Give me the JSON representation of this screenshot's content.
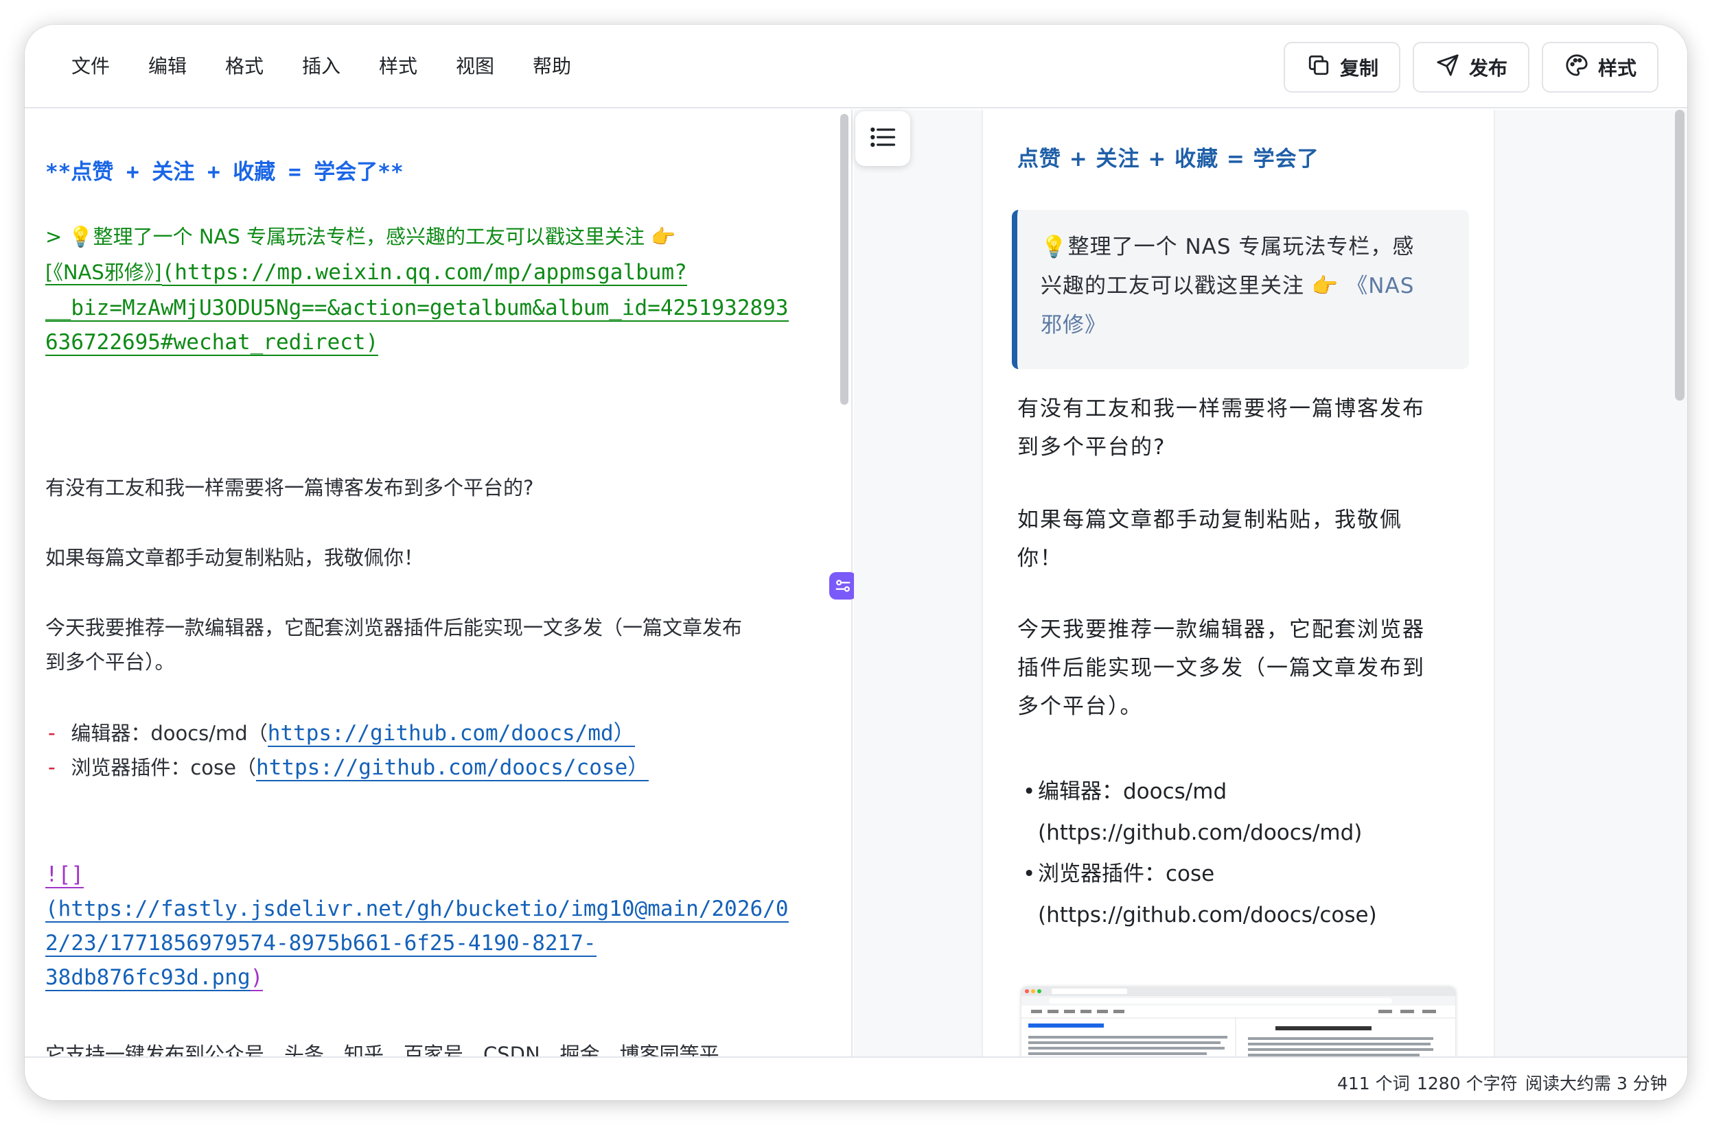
{
  "menu": [
    "文件",
    "编辑",
    "格式",
    "插入",
    "样式",
    "视图",
    "帮助"
  ],
  "toolbar": {
    "copy_label": "复制",
    "publish_label": "发布",
    "style_label": "样式"
  },
  "editor": {
    "heading": "**点赞 + 关注 + 收藏 = 学会了**",
    "quote_prefix": "> 💡整理了一个 NAS 专属玩法专栏，感兴趣的工友可以戳这里关注 👉",
    "quote_link_text": "[《NAS邪修》]",
    "quote_link_url_1": "(https://mp.weixin.qq.com/mp/appmsgalbum?",
    "quote_link_url_2": "__biz=MzAwMjU3ODU5Ng==&action=getalbum&album_id=4251932893",
    "quote_link_url_3": "636722695#wechat_redirect",
    "quote_link_close": ")",
    "p1": "有没有工友和我一样需要将一篇博客发布到多个平台的?",
    "p2": "如果每篇文章都手动复制粘贴，我敬佩你！",
    "p3_1": "今天我要推荐一款编辑器，它配套浏览器插件后能实现一文多发（一篇文章发布",
    "p3_2": "到多个平台）。",
    "li1_dash": "-",
    "li1_label": "编辑器：doocs/md（",
    "li1_link": "https://github.com/doocs/md）",
    "li2_dash": "-",
    "li2_label": "浏览器插件：cose（",
    "li2_link": "https://github.com/doocs/cose）",
    "img_mark": "![]",
    "img_url_1": "(https://fastly.jsdelivr.net/gh/bucketio/img10@main/2026/0",
    "img_url_2": "2/23/1771856979574-8975b661-6f25-4190-8217-",
    "img_url_3": "38db876fc93d.png",
    "img_close": ")",
    "partial_line": "它支持一键发布到公众号、头条、知乎、百家号、CSDN、掘金、博客园等平"
  },
  "preview": {
    "heading": "点赞 + 关注 + 收藏 = 学会了",
    "quote_1": "💡整理了一个 NAS 专属玩法专栏，感",
    "quote_2": "兴趣的工友可以戳这里关注 👉",
    "quote_link_1": "《NAS",
    "quote_link_2": "邪修》",
    "p1_1": "有没有工友和我一样需要将一篇博客发布",
    "p1_2": "到多个平台的?",
    "p2_1": "如果每篇文章都手动复制粘贴，我敬佩",
    "p2_2": "你！",
    "p3_1": "今天我要推荐一款编辑器，它配套浏览器",
    "p3_2": "插件后能实现一文多发（一篇文章发布到",
    "p3_3": "多个平台）。",
    "li1_1": "编辑器：doocs/md",
    "li1_2": "(https://github.com/doocs/md)",
    "li2_1": "浏览器插件：cose",
    "li2_2": "(https://github.com/doocs/cose)",
    "bullet": "•"
  },
  "status": {
    "words": "411 个词",
    "chars": "1280 个字符",
    "read_time": "阅读大约需 3 分钟"
  },
  "colors": {
    "accent": "#1f5fa8",
    "editor_link": "#1461b8",
    "green": "#0e8a16",
    "purple": "#a235c9",
    "red": "#d7263d"
  },
  "icons": [
    "copy-icon",
    "send-icon",
    "palette-icon",
    "outline-list-icon",
    "toggle-icon"
  ]
}
